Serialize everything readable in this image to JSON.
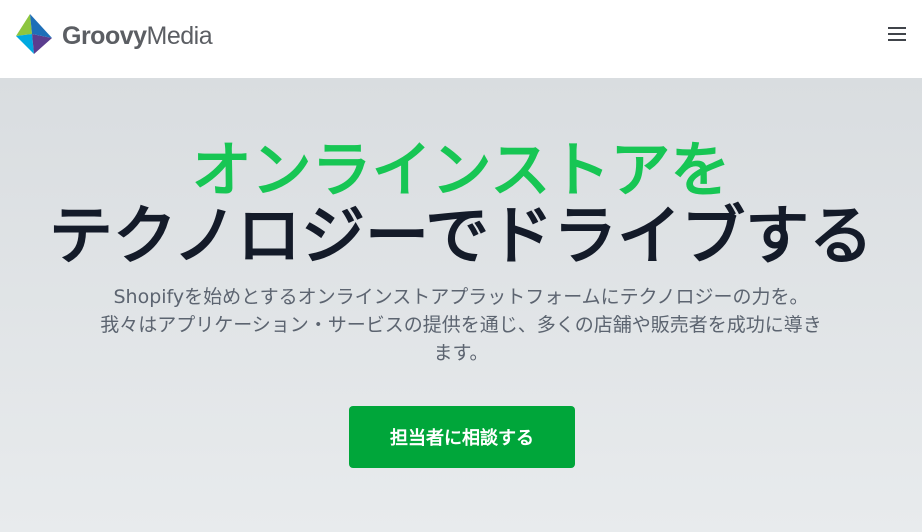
{
  "header": {
    "brand_groovy": "Groovy",
    "brand_media": "Media",
    "menu_icon": "hamburger-menu-icon",
    "logo_colors": [
      "#8dc63f",
      "#00a9e0",
      "#5b3d8f",
      "#1e6fb8"
    ]
  },
  "hero": {
    "title_line1": "オンラインストアを",
    "title_line2": "テクノロジーでドライブする",
    "description": [
      "Shopifyを始めとするオンラインストアプラットフォームにテクノロジーの力を。",
      "我々はアプリケーション・サービスの提供を通じ、多くの店舗や販売者を成功に導き",
      "ます。"
    ],
    "cta_label": "担当者に相談する"
  },
  "colors": {
    "accent_green": "#17c654",
    "cta_green": "#00a63a",
    "heading_dark": "#141b29",
    "hero_bg": "#d9dde0"
  }
}
